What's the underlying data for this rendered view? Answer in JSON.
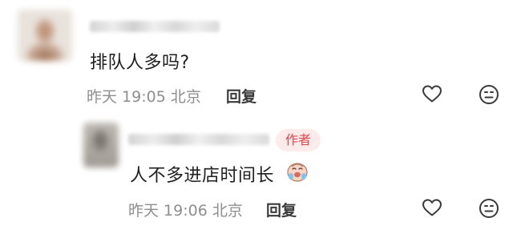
{
  "comments": [
    {
      "text": "排队人多吗?",
      "time": "昨天 19:05 北京",
      "reply_label": "回复",
      "icons": [
        "heart-icon",
        "neutral-face-icon"
      ]
    },
    {
      "badge": "作者",
      "text": "人不多进店时间长",
      "emoji": "crying-face-emoji",
      "time": "昨天 19:06 北京",
      "reply_label": "回复",
      "icons": [
        "heart-icon",
        "neutral-face-icon"
      ]
    }
  ],
  "colors": {
    "badge_text": "#e2474a",
    "badge_bg": "#fdebeb",
    "meta": "#8e8e8e"
  }
}
